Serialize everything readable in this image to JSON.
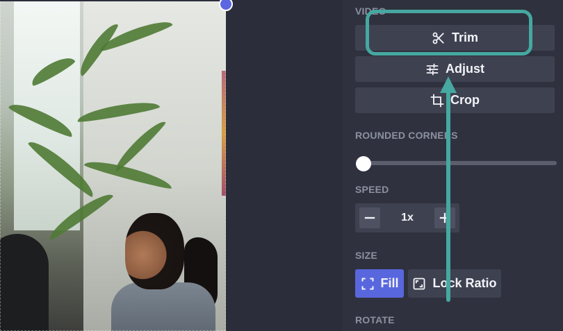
{
  "panel": {
    "video_section": {
      "label": "VIDEO",
      "buttons": [
        {
          "label": "Trim",
          "icon": "scissors-icon"
        },
        {
          "label": "Adjust",
          "icon": "sliders-icon"
        },
        {
          "label": "Crop",
          "icon": "crop-icon"
        }
      ]
    },
    "rounded_corners": {
      "label": "ROUNDED CORNERS",
      "level": 0
    },
    "speed": {
      "label": "SPEED",
      "value": "1x",
      "minus_icon": "minus-icon",
      "plus_icon": "plus-icon"
    },
    "size": {
      "label": "SIZE",
      "fill_label": "Fill",
      "fill_icon": "expand-corners-icon",
      "lock_label": "Lock Ratio",
      "lock_icon": "aspect-ratio-icon",
      "selected": "Fill"
    },
    "rotate": {
      "label": "ROTATE"
    }
  },
  "colors": {
    "accent": "#5867dd",
    "annotation": "#46a8a0",
    "panel_bg": "#2f323e",
    "button_bg": "#3e4150"
  }
}
